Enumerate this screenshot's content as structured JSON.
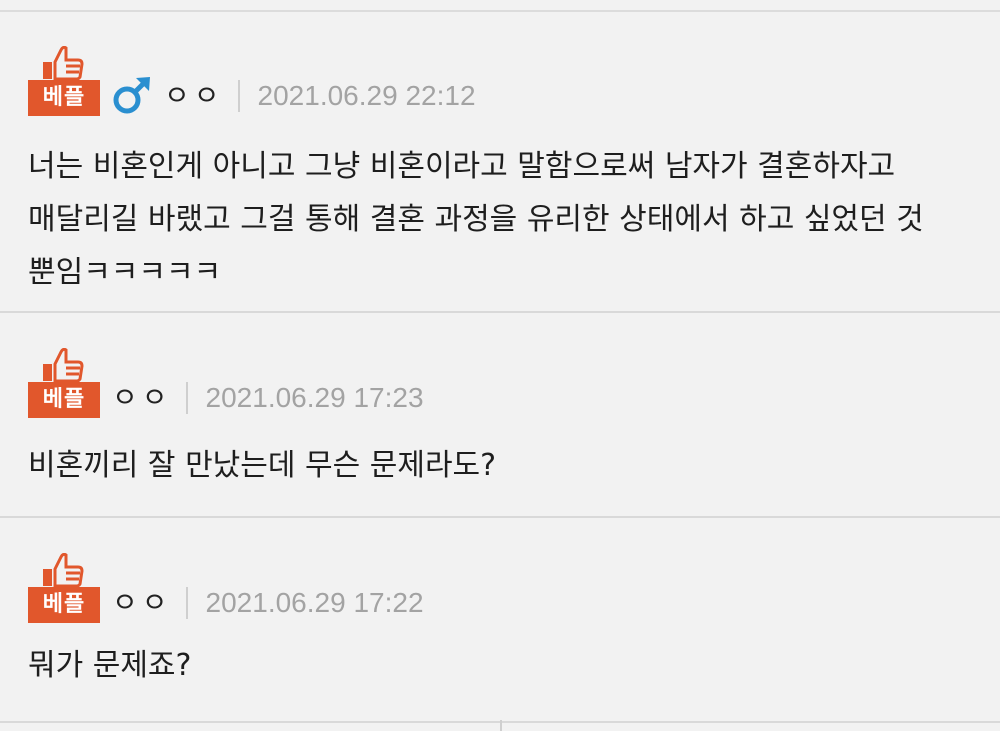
{
  "comments": [
    {
      "badge_label": "베플",
      "gender_icon": "male-icon",
      "nickname": "ㅇㅇ",
      "timestamp": "2021.06.29 22:12",
      "text": "너는 비혼인게 아니고 그냥 비혼이라고 말함으로써 남자가 결혼하자고\n매달리길 바랬고 그걸 통해 결혼 과정을 유리한 상태에서 하고 싶었던 것\n뿐임ㅋㅋㅋㅋㅋ"
    },
    {
      "badge_label": "베플",
      "nickname": "ㅇㅇ",
      "timestamp": "2021.06.29 17:23",
      "text": "비혼끼리 잘 만났는데 무슨 문제라도?"
    },
    {
      "badge_label": "베플",
      "nickname": "ㅇㅇ",
      "timestamp": "2021.06.29 17:22",
      "text": "뭐가 문제죠?"
    }
  ],
  "colors": {
    "badge": "#e1572c",
    "gender_male": "#2a8fd0",
    "timestamp": "#a3a3a3"
  }
}
